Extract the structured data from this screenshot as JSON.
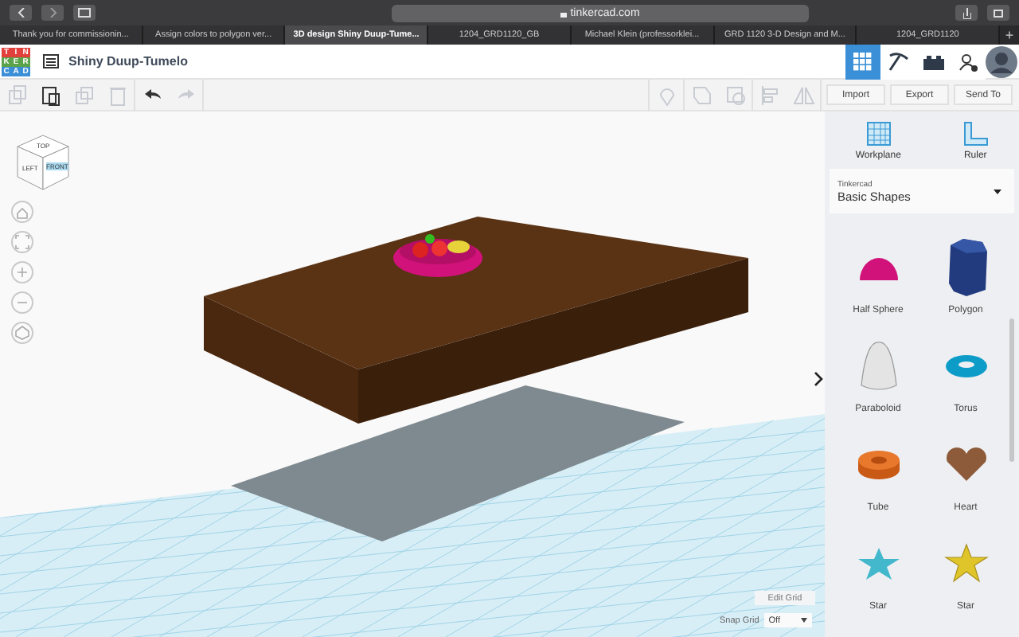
{
  "browser": {
    "url": "tinkercad.com",
    "tabs": [
      {
        "title": "Thank you for commissionin...",
        "selected": false
      },
      {
        "title": "Assign colors to polygon ver...",
        "selected": false
      },
      {
        "title": "3D design Shiny Duup-Tume...",
        "selected": true
      },
      {
        "title": "1204_GRD1120_GB",
        "selected": false
      },
      {
        "title": "Michael Klein (professorklei...",
        "selected": false
      },
      {
        "title": "GRD 1120 3-D Design and M...",
        "selected": false
      },
      {
        "title": "1204_GRD1120",
        "selected": false
      }
    ],
    "new_tab": "+"
  },
  "logo": [
    {
      "letter": "T",
      "color": "#e2403c"
    },
    {
      "letter": "I",
      "color": "#e2403c"
    },
    {
      "letter": "N",
      "color": "#e2403c"
    },
    {
      "letter": "K",
      "color": "#5ba34a"
    },
    {
      "letter": "E",
      "color": "#5ba34a"
    },
    {
      "letter": "R",
      "color": "#5ba34a"
    },
    {
      "letter": "C",
      "color": "#3a8fd6"
    },
    {
      "letter": "A",
      "color": "#3a8fd6"
    },
    {
      "letter": "D",
      "color": "#3a8fd6"
    }
  ],
  "design_title": "Shiny Duup-Tumelo",
  "mode_tabs": [
    {
      "kind": "grid",
      "selected": true
    },
    {
      "kind": "pickaxe",
      "selected": false
    },
    {
      "kind": "bricks",
      "selected": false
    }
  ],
  "edit_tools": [
    {
      "kind": "copy",
      "disabled": true
    },
    {
      "kind": "paste",
      "disabled": false
    },
    {
      "kind": "duplicate",
      "disabled": true
    },
    {
      "kind": "delete",
      "disabled": true
    },
    {
      "kind": "undo",
      "disabled": false
    },
    {
      "kind": "redo",
      "disabled": true
    }
  ],
  "shape_tools": [
    {
      "kind": "note",
      "disabled": true
    },
    {
      "kind": "group",
      "disabled": true
    },
    {
      "kind": "ungroup",
      "disabled": true
    },
    {
      "kind": "align",
      "disabled": true
    },
    {
      "kind": "mirror",
      "disabled": true
    }
  ],
  "actions": [
    "Import",
    "Export",
    "Send To"
  ],
  "helpers": [
    {
      "kind": "workplane",
      "label": "Workplane"
    },
    {
      "kind": "ruler",
      "label": "Ruler"
    }
  ],
  "library": {
    "source": "Tinkercad",
    "value": "Basic Shapes"
  },
  "shapes": [
    {
      "kind": "half-sphere",
      "label": "Half Sphere"
    },
    {
      "kind": "polygon",
      "label": "Polygon"
    },
    {
      "kind": "paraboloid",
      "label": "Paraboloid"
    },
    {
      "kind": "torus",
      "label": "Torus"
    },
    {
      "kind": "tube",
      "label": "Tube"
    },
    {
      "kind": "heart",
      "label": "Heart"
    },
    {
      "kind": "star-blue",
      "label": "Star"
    },
    {
      "kind": "star-yellow",
      "label": "Star"
    }
  ],
  "viewcube": {
    "top": "TOP",
    "left": "LEFT",
    "front": "FRONT"
  },
  "view_controls": [
    {
      "kind": "home"
    },
    {
      "kind": "fit"
    },
    {
      "kind": "zoom-in"
    },
    {
      "kind": "zoom-out"
    },
    {
      "kind": "perspective"
    }
  ],
  "grid": {
    "edit_button": "Edit Grid",
    "snap_label": "Snap Grid",
    "snap_value": "Off"
  }
}
